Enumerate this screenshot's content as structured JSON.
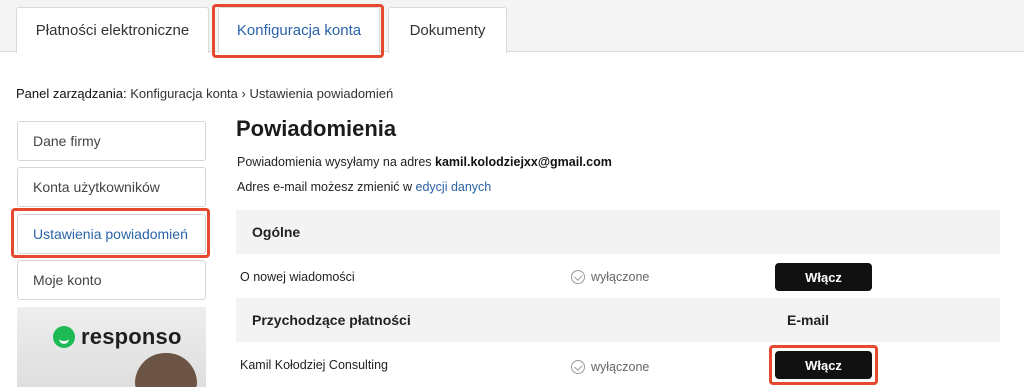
{
  "tabs": [
    {
      "label": "Płatności elektroniczne"
    },
    {
      "label": "Konfiguracja konta",
      "active": true
    },
    {
      "label": "Dokumenty"
    }
  ],
  "breadcrumb": {
    "root": "Panel zarządzania:",
    "path": "Konfiguracja konta › Ustawienia powiadomień"
  },
  "sidebar": {
    "items": [
      {
        "label": "Dane firmy"
      },
      {
        "label": "Konta użytkowników"
      },
      {
        "label": "Ustawienia powiadomień",
        "active": true
      },
      {
        "label": "Moje konto"
      }
    ],
    "ad": {
      "brand": "responso"
    }
  },
  "main": {
    "title": "Powiadomienia",
    "info_prefix": "Powiadomienia wysyłamy na adres ",
    "email": "kamil.kolodziejxx@gmail.com",
    "info2_prefix": "Adres e-mail możesz zmienić w ",
    "info2_link": "edycji danych",
    "sections": [
      {
        "title": "Ogólne",
        "column": "",
        "rows": [
          {
            "label": "O nowej wiadomości",
            "status": "wyłączone",
            "button": "Włącz"
          }
        ]
      },
      {
        "title": "Przychodzące płatności",
        "column": "E-mail",
        "rows": [
          {
            "label": "Kamil Kołodziej Consulting",
            "status": "wyłączone",
            "button": "Włącz"
          }
        ]
      }
    ]
  },
  "colors": {
    "accent": "#2a63a8",
    "highlight": "#e64a2e",
    "button": "#111111"
  }
}
